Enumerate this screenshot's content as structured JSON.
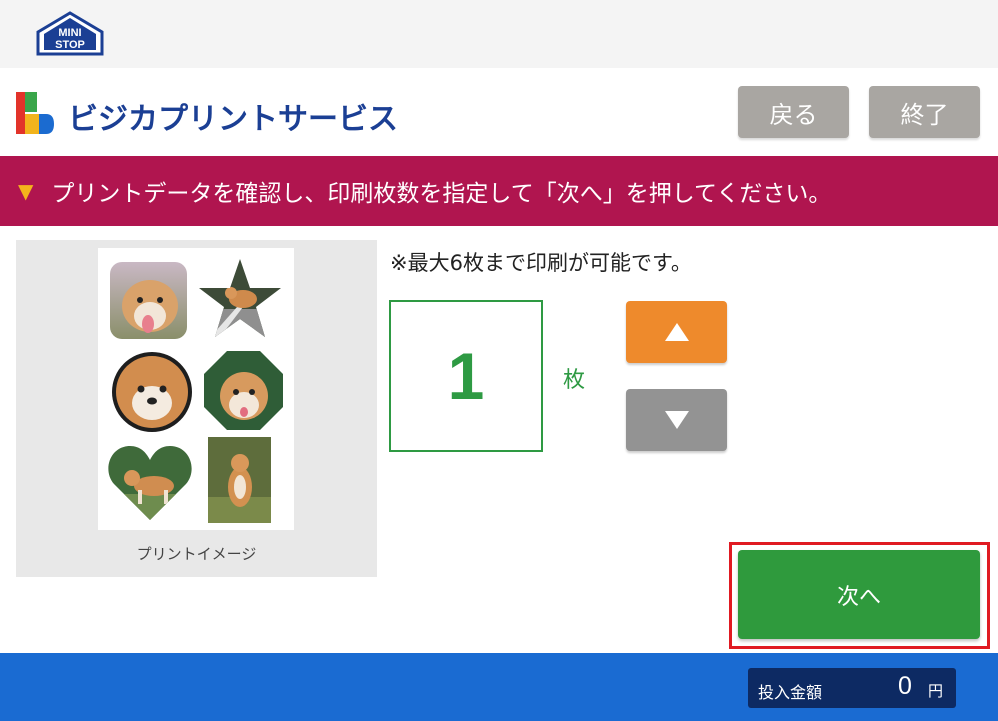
{
  "brand": {
    "logo_text_line1": "MINI",
    "logo_text_line2": "STOP"
  },
  "header": {
    "service_title": "ビジカプリントサービス",
    "back_label": "戻る",
    "end_label": "終了"
  },
  "banner": {
    "marker": "▼",
    "instruction": "プリントデータを確認し、印刷枚数を指定して「次へ」を押してください。"
  },
  "preview": {
    "caption": "プリントイメージ"
  },
  "quantity": {
    "note": "※最大6枚まで印刷が可能です。",
    "value": "1",
    "unit": "枚",
    "max": 6
  },
  "actions": {
    "next_label": "次へ"
  },
  "footer": {
    "amount_label": "投入金額",
    "amount_value": "0",
    "amount_unit": "円"
  },
  "colors": {
    "banner": "#b0154f",
    "accent_green": "#2e9a43",
    "increment": "#ee8a2c",
    "footer": "#1a6bd2"
  }
}
